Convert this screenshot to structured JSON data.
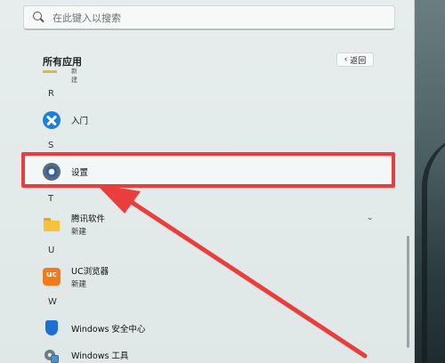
{
  "search": {
    "placeholder": "在此键入以搜索"
  },
  "all_apps": {
    "title": "所有应用",
    "back_label": "返回"
  },
  "partial_item": {
    "text": "新建"
  },
  "groups": [
    {
      "letter": "R"
    },
    {
      "letter": "S"
    },
    {
      "letter": "T"
    },
    {
      "letter": "U"
    },
    {
      "letter": "W"
    }
  ],
  "apps": {
    "rumen": {
      "name": "入门",
      "icon": "get-started-icon"
    },
    "settings": {
      "name": "设置",
      "icon": "gear-icon"
    },
    "tencent": {
      "name": "腾讯软件",
      "sub": "新建",
      "icon": "folder-icon"
    },
    "uc": {
      "name": "UC浏览器",
      "sub": "新建",
      "icon": "uc-browser-icon"
    },
    "security": {
      "name": "Windows 安全中心",
      "icon": "shield-icon"
    },
    "tools": {
      "name": "Windows 工具",
      "icon": "tools-icon"
    }
  },
  "colors": {
    "highlight": "#e83e3e",
    "accent": "#1d7fd6"
  }
}
